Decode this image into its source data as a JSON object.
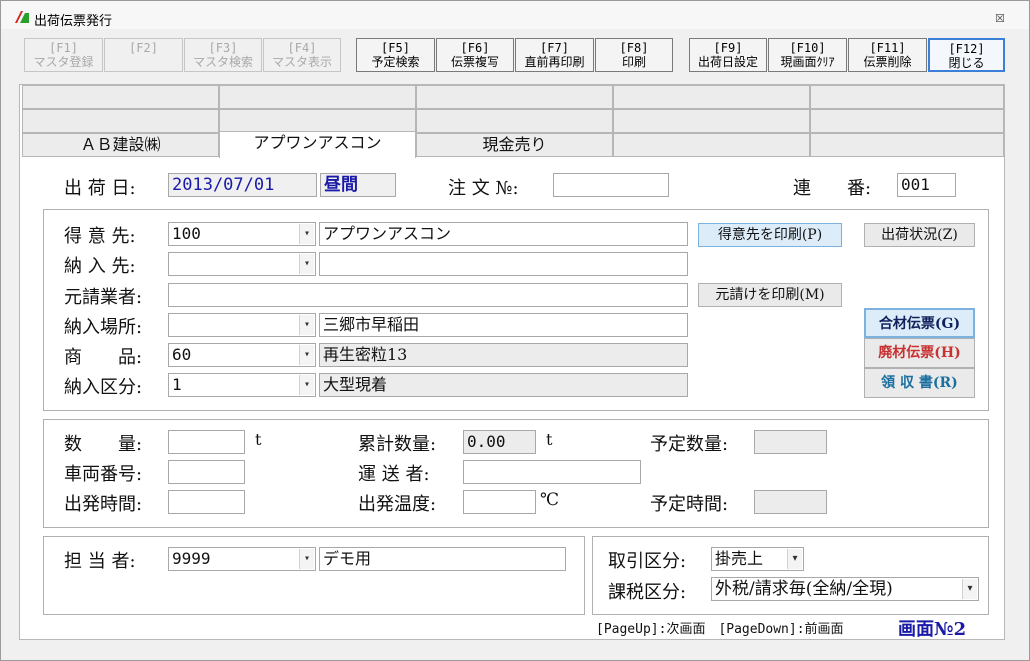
{
  "window": {
    "title": "出荷伝票発行",
    "close": "☒"
  },
  "fkeys": [
    {
      "key": "[F1]",
      "label": "マスタ登録"
    },
    {
      "key": "[F2]",
      "label": ""
    },
    {
      "key": "[F3]",
      "label": "マスタ検索"
    },
    {
      "key": "[F4]",
      "label": "マスタ表示"
    },
    {
      "key": "[F5]",
      "label": "予定検索"
    },
    {
      "key": "[F6]",
      "label": "伝票複写"
    },
    {
      "key": "[F7]",
      "label": "直前再印刷"
    },
    {
      "key": "[F8]",
      "label": "印刷"
    },
    {
      "key": "[F9]",
      "label": "出荷日設定"
    },
    {
      "key": "[F10]",
      "label": "現画面ｸﾘｱ"
    },
    {
      "key": "[F11]",
      "label": "伝票削除"
    },
    {
      "key": "[F12]",
      "label": "閉じる"
    }
  ],
  "tabs": [
    "ＡＢ建設㈱",
    "アプワンアスコン",
    "現金売り"
  ],
  "header": {
    "ship_date_label": "出 荷 日:",
    "ship_date": "2013/07/01",
    "time_slot": "昼間",
    "order_no_label": "注 文 №:",
    "order_no": "",
    "serial_label": "連　　番:",
    "serial": "001"
  },
  "customer": {
    "customer_label": "得 意 先:",
    "customer_code": "100",
    "customer_name": "アプワンアスコン",
    "delivery_label": "納 入 先:",
    "delivery_code": "",
    "delivery_name": "",
    "contractor_label": "元請業者:",
    "contractor": "",
    "place_label": "納入場所:",
    "place_code": "",
    "place_name": "三郷市早稲田",
    "product_label": "商　　品:",
    "product_code": "60",
    "product_name": "再生密粒13",
    "division_label": "納入区分:",
    "division_code": "1",
    "division_name": "大型現着",
    "print_customer_btn": "得意先を印刷(P)",
    "print_contractor_btn": "元請けを印刷(M)",
    "status_btn": "出荷状況(Z)",
    "slip_total_btn": "合材伝票(G)",
    "slip_waste_btn": "廃材伝票(H)",
    "receipt_btn": "領 収 書(R)",
    "slip_waste_color": "#c83232",
    "receipt_color": "#1a6fa0",
    "slip_total_color": "#10205a"
  },
  "quantity": {
    "qty_label": "数　　量:",
    "qty": "",
    "qty_unit": "t",
    "cum_label": "累計数量:",
    "cum": "0.00",
    "cum_unit": "t",
    "planned_label": "予定数量:",
    "planned": "",
    "vehicle_label": "車両番号:",
    "vehicle": "",
    "carrier_label": "運 送 者:",
    "carrier": "",
    "depart_time_label": "出発時間:",
    "depart_time": "",
    "depart_temp_label": "出発温度:",
    "depart_temp": "",
    "temp_unit": "℃",
    "planned_time_label": "予定時間:",
    "planned_time": ""
  },
  "staff": {
    "staff_label": "担 当 者:",
    "staff_code": "9999",
    "staff_name": "デモ用",
    "trade_label": "取引区分:",
    "trade": "掛売上",
    "tax_label": "課税区分:",
    "tax": "外税/請求毎(全納/全現)"
  },
  "footer": {
    "page_nav": "[PageUp]:次画面　[PageDown]:前画面",
    "screen_no": "画面№2"
  }
}
